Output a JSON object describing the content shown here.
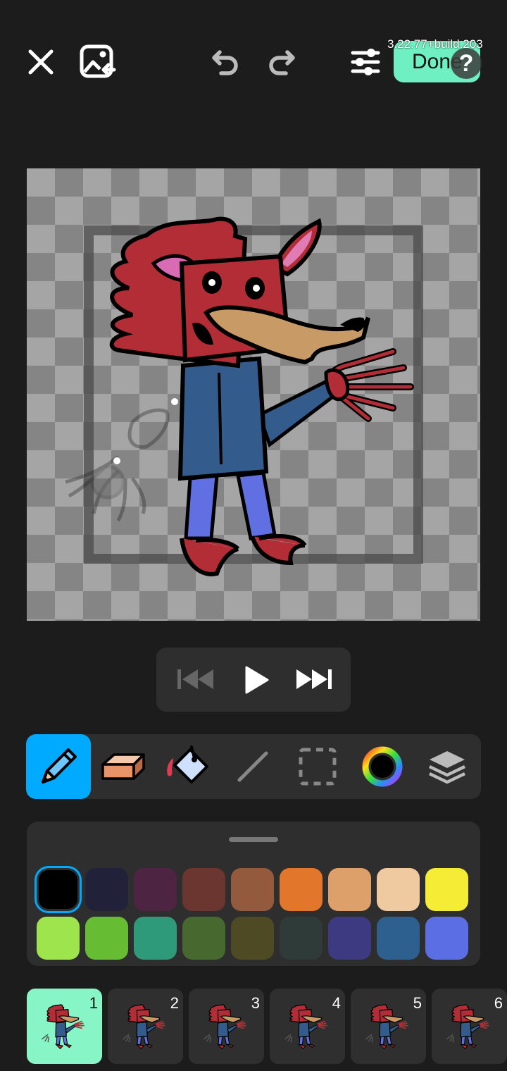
{
  "top_bar": {
    "close": "close-icon",
    "gallery": "image-import-icon",
    "undo": "undo-icon",
    "redo": "redo-icon",
    "settings": "sliders-icon",
    "done_label": "Done",
    "build": "3.22.77+build.203",
    "help": "?"
  },
  "playback": {
    "first": "skip-back-icon",
    "play": "play-icon",
    "next": "skip-forward-icon"
  },
  "tools": [
    {
      "name": "pencil",
      "icon": "pencil-icon",
      "selected": true
    },
    {
      "name": "eraser",
      "icon": "eraser-icon",
      "selected": false
    },
    {
      "name": "fill",
      "icon": "fill-bucket-icon",
      "selected": false
    },
    {
      "name": "line",
      "icon": "line-icon",
      "selected": false
    },
    {
      "name": "select",
      "icon": "selection-icon",
      "selected": false
    },
    {
      "name": "color",
      "icon": "color-wheel-icon",
      "selected": false
    },
    {
      "name": "layers",
      "icon": "layers-icon",
      "selected": false
    }
  ],
  "palette": {
    "selected_index": 0,
    "colors": [
      "#000000",
      "#22213a",
      "#4d2442",
      "#6b3630",
      "#935a3e",
      "#e2762a",
      "#dea06a",
      "#efc99f",
      "#f5ec35",
      "#9ee44d",
      "#66bd33",
      "#2f9a79",
      "#47692f",
      "#4e4b24",
      "#2f3b38",
      "#3e3a81",
      "#2e608f",
      "#5b6ee3"
    ]
  },
  "frames": [
    {
      "label": "1",
      "selected": true
    },
    {
      "label": "2",
      "selected": false
    },
    {
      "label": "3",
      "selected": false
    },
    {
      "label": "4",
      "selected": false
    },
    {
      "label": "5",
      "selected": false
    },
    {
      "label": "6",
      "selected": false
    }
  ],
  "colors": {
    "accent_tool": "#00aaff",
    "done_bg": "#6ff0c2",
    "frame_selected": "#88f5c7"
  }
}
